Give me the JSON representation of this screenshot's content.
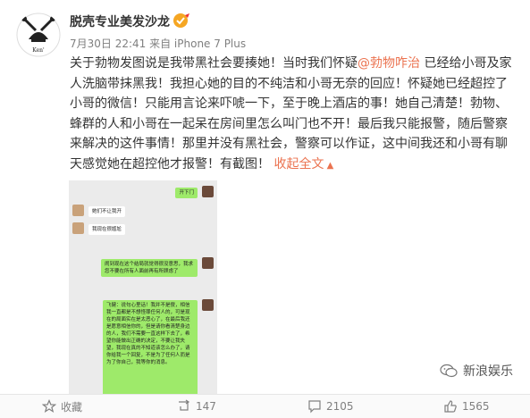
{
  "post": {
    "username": "脱壳专业美发沙龙",
    "meta": "7月30日 22:41 来自 iPhone 7 Plus",
    "text": {
      "before_mention": "关于勃物发图说是我带黑社会要揍她！当时我们怀疑",
      "mention": "@勃物咋治",
      "after_mention": " 已经给小哥及家人洗脑带抹黑我！我担心她的目的不纯洁和小哥无奈的回应！怀疑她已经超控了小哥的微信！只能用言论来吓唬一下，至于晚上酒店的事！她自己清楚！勃物、蜂群的人和小哥在一起呆在房间里怎么叫门也不开！最后我只能报警，随后警察来解决的这件事情！那里并没有黑社会，警察可以作证，这中间我还和小哥有聊天感觉她在超控他才报警！有截图！",
      "collapse": "收起全文"
    }
  },
  "chat_screenshot": {
    "messages": [
      {
        "side": "right",
        "text": "开下门"
      },
      {
        "side": "left",
        "text": "她们不让我开"
      },
      {
        "side": "left",
        "text": "我现在很尴尬"
      },
      {
        "side": "right",
        "text": "闹到现在这个结局就觉得很没意思，我求您不要在所有人面前再有所顾虑了"
      },
      {
        "side": "right",
        "text": "飞健：说句心里话！我并不是傻，相信我一直都是不想怪罪任何人的，可是现在的局面实在是太恶心了，在最后我还是愿意相信你的，但是请你看清楚身边的人，我们不需要一直这样下去了，希望你能做出正确的决定，不要让我失望，我现在真的不知道该怎么办了，请你给我一个回复，不是为了任何人而是为了你自己，我等你的消息。"
      }
    ]
  },
  "actions": {
    "favorite": "收藏",
    "repost": "147",
    "comment": "2105",
    "like": "1565"
  },
  "watermark": {
    "text": "新浪娱乐"
  }
}
